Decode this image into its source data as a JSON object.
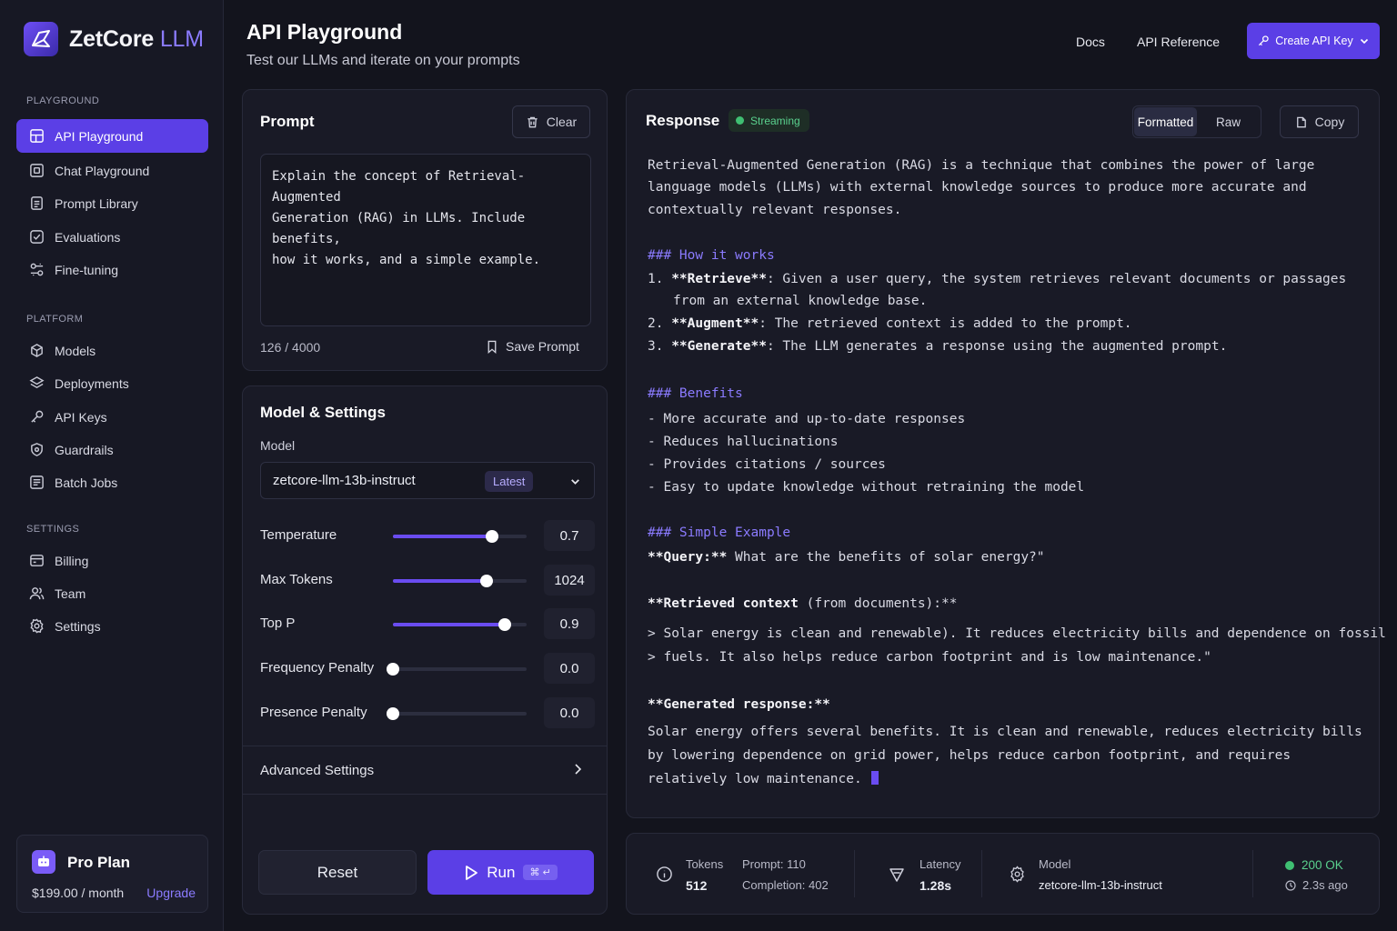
{
  "brand": {
    "name": "ZetCore",
    "suffix": "LLM"
  },
  "sidebar": {
    "playground_label": "PLAYGROUND",
    "platform_label": "PLATFORM",
    "settings_label": "SETTINGS",
    "playground_items": [
      {
        "label": "API Playground",
        "icon": "grid-icon"
      },
      {
        "label": "Chat Playground",
        "icon": "chat-icon"
      },
      {
        "label": "Prompt Library",
        "icon": "document-icon"
      },
      {
        "label": "Evaluations",
        "icon": "check-square-icon"
      },
      {
        "label": "Fine-tuning",
        "icon": "tune-icon"
      }
    ],
    "platform_items": [
      {
        "label": "Models",
        "icon": "cube-icon"
      },
      {
        "label": "Deployments",
        "icon": "layers-icon"
      },
      {
        "label": "API Keys",
        "icon": "key-icon"
      },
      {
        "label": "Guardrails",
        "icon": "shield-icon"
      },
      {
        "label": "Batch Jobs",
        "icon": "stack-icon"
      }
    ],
    "settings_items": [
      {
        "label": "Billing",
        "icon": "card-icon"
      },
      {
        "label": "Team",
        "icon": "users-icon"
      },
      {
        "label": "Settings",
        "icon": "gear-icon"
      }
    ],
    "plan": {
      "name": "Pro Plan",
      "price": "$199.00 / month",
      "upgrade": "Upgrade"
    }
  },
  "header": {
    "title": "API Playground",
    "subtitle": "Test our LLMs and iterate on your prompts",
    "links": {
      "docs": "Docs",
      "api_reference": "API Reference"
    },
    "create_key": "Create API Key"
  },
  "prompt": {
    "title": "Prompt",
    "clear": "Clear",
    "text": "Explain the concept of Retrieval-Augmented\nGeneration (RAG) in LLMs. Include benefits,\nhow it works, and a simple example.",
    "count": "126 / 4000",
    "save": "Save Prompt"
  },
  "settings": {
    "title": "Model & Settings",
    "model_label": "Model",
    "model_value": "zetcore-llm-13b-instruct",
    "model_badge": "Latest",
    "params": [
      {
        "label": "Temperature",
        "value": "0.7",
        "level": 0.74
      },
      {
        "label": "Max Tokens",
        "value": "1024",
        "level": 0.7
      },
      {
        "label": "Top P",
        "value": "0.9",
        "level": 0.84
      },
      {
        "label": "Frequency Penalty",
        "value": "0.0",
        "level": 0.0
      },
      {
        "label": "Presence Penalty",
        "value": "0.0",
        "level": 0.0
      }
    ],
    "advanced": "Advanced Settings",
    "reset": "Reset",
    "run": "Run",
    "run_shortcut": "⌘ ↵"
  },
  "response": {
    "title": "Response",
    "status": "Streaming",
    "view_formatted": "Formatted",
    "view_raw": "Raw",
    "copy": "Copy",
    "intro": [
      "Retrieval-Augmented Generation (RAG) is a technique that combines the power of large",
      "language models (LLMs) with external knowledge sources to produce more accurate and",
      "contextually relevant responses."
    ],
    "how_heading": "### How it works",
    "steps": [
      {
        "num": "1.",
        "bold": "**Retrieve**",
        "text": ": Given a user query, the system retrieves relevant documents or passages"
      },
      {
        "num": "",
        "bold": "",
        "text": "from an external knowledge base."
      },
      {
        "num": "2.",
        "bold": "**Augment**",
        "text": ": The retrieved context is added to the prompt."
      },
      {
        "num": "3.",
        "bold": "**Generate**",
        "text": ": The LLM generates a response using the augmented prompt."
      }
    ],
    "benefits_heading": "### Benefits",
    "benefits": [
      "- More accurate and up-to-date responses",
      "- Reduces hallucinations",
      "- Provides citations / sources",
      "- Easy to update knowledge without retraining the model"
    ],
    "example_heading": "### Simple Example",
    "query_label": "**Query:**",
    "query_text": " What are the benefits of solar energy?\"",
    "retrieved_label": "**Retrieved context",
    "retrieved_rest": " (from documents):**",
    "quote": [
      "> Solar energy is clean and renewable). It reduces electricity bills and dependence on fossil",
      "> fuels. It also helps reduce carbon footprint and is low maintenance.\""
    ],
    "generated_label": "**Generated response:**",
    "generated": [
      "Solar energy offers several benefits. It is clean and renewable, reduces electricity bills",
      "by lowering dependence on grid power, helps reduce carbon footprint, and requires",
      "relatively low maintenance."
    ]
  },
  "stats": {
    "tokens_label": "Tokens",
    "tokens_value": "512",
    "prompt_tokens": "Prompt: 110",
    "completion_tokens": "Completion: 402",
    "latency_label": "Latency",
    "latency_value": "1.28s",
    "model_label": "Model",
    "model_value": "zetcore-llm-13b-instruct",
    "status": "200 OK",
    "time_ago": "2.3s ago"
  },
  "colors": {
    "accent": "#5b3fe6",
    "accent_light": "#8b7bff",
    "success": "#3fbf72",
    "background": "#13141d"
  }
}
